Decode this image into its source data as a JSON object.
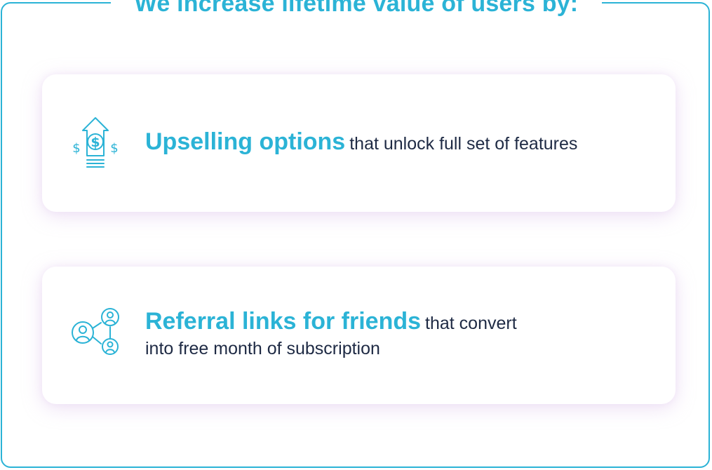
{
  "heading": "We increase lifetime value of users by:",
  "colors": {
    "accent": "#2bb3d6",
    "text": "#1e2a44"
  },
  "items": [
    {
      "icon": "dollar-upsell-icon",
      "highlight": "Upselling options",
      "line1": "that unlock full set of features",
      "line2": ""
    },
    {
      "icon": "referral-network-icon",
      "highlight": "Referral links for friends",
      "line1": "that convert",
      "line2": "into free month of subscription"
    }
  ]
}
